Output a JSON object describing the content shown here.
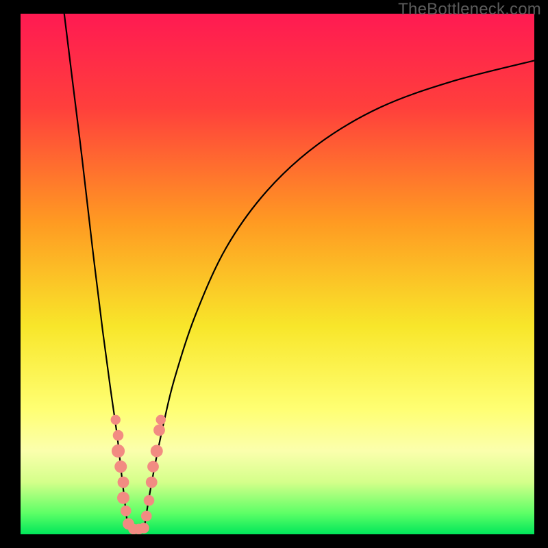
{
  "watermark": "TheBottleneck.com",
  "chart_data": {
    "type": "line",
    "title": "",
    "xlabel": "",
    "ylabel": "",
    "xlim": [
      0,
      100
    ],
    "ylim": [
      0,
      100
    ],
    "grid": false,
    "legend": false,
    "gradient_stops": [
      {
        "offset": 0,
        "color": "#ff1a52"
      },
      {
        "offset": 18,
        "color": "#ff3f3c"
      },
      {
        "offset": 40,
        "color": "#ff9a22"
      },
      {
        "offset": 60,
        "color": "#f8e62a"
      },
      {
        "offset": 76,
        "color": "#ffff73"
      },
      {
        "offset": 84,
        "color": "#fbffad"
      },
      {
        "offset": 90,
        "color": "#d4ff8a"
      },
      {
        "offset": 96,
        "color": "#5cff66"
      },
      {
        "offset": 100,
        "color": "#00e65a"
      }
    ],
    "series": [
      {
        "name": "left-branch",
        "x": [
          8.5,
          10,
          12,
          14,
          16,
          17.5,
          18.8,
          19.6,
          20.2,
          20.8
        ],
        "y": [
          100,
          88,
          72,
          55,
          39,
          28,
          19,
          12,
          7,
          2
        ]
      },
      {
        "name": "right-branch",
        "x": [
          24.2,
          25,
          26.3,
          28,
          30,
          34,
          40,
          48,
          58,
          70,
          84,
          100
        ],
        "y": [
          2,
          7,
          14,
          22,
          30,
          42,
          55,
          66,
          75,
          82,
          87,
          91
        ]
      }
    ],
    "bottom_join": {
      "x": [
        20.8,
        22.5,
        24.2
      ],
      "y": [
        2,
        0.8,
        2
      ]
    },
    "markers": {
      "color": "#f28b82",
      "points": [
        {
          "x": 18.5,
          "y": 22,
          "r": 1.2
        },
        {
          "x": 19.0,
          "y": 19,
          "r": 1.3
        },
        {
          "x": 19.0,
          "y": 16,
          "r": 1.6
        },
        {
          "x": 19.5,
          "y": 13,
          "r": 1.5
        },
        {
          "x": 20.0,
          "y": 10,
          "r": 1.4
        },
        {
          "x": 20.0,
          "y": 7,
          "r": 1.5
        },
        {
          "x": 20.5,
          "y": 4.5,
          "r": 1.3
        },
        {
          "x": 21.0,
          "y": 2.0,
          "r": 1.4
        },
        {
          "x": 22.0,
          "y": 1.0,
          "r": 1.3
        },
        {
          "x": 23.0,
          "y": 1.0,
          "r": 1.3
        },
        {
          "x": 24.0,
          "y": 1.2,
          "r": 1.3
        },
        {
          "x": 24.5,
          "y": 3.5,
          "r": 1.3
        },
        {
          "x": 25.0,
          "y": 6.5,
          "r": 1.3
        },
        {
          "x": 25.5,
          "y": 10,
          "r": 1.4
        },
        {
          "x": 25.8,
          "y": 13,
          "r": 1.4
        },
        {
          "x": 26.5,
          "y": 16,
          "r": 1.5
        },
        {
          "x": 27.0,
          "y": 20,
          "r": 1.4
        },
        {
          "x": 27.3,
          "y": 22,
          "r": 1.2
        }
      ]
    }
  }
}
